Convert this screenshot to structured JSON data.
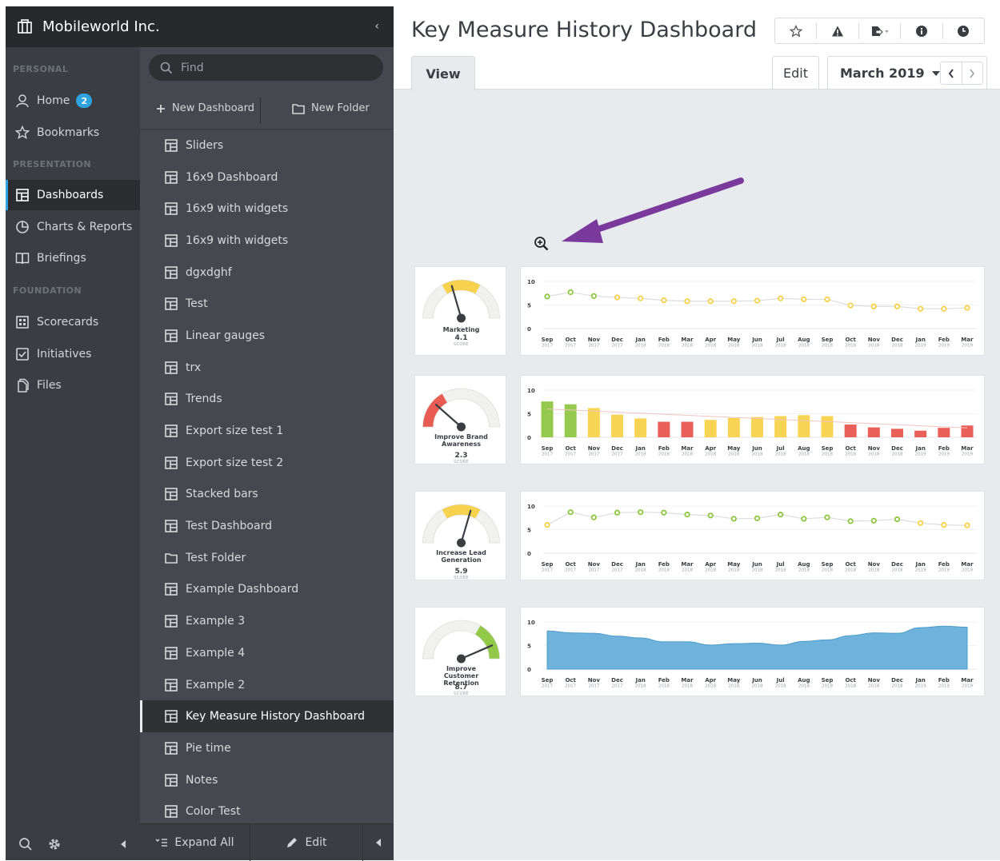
{
  "org": {
    "name": "Mobileworld Inc."
  },
  "nav": {
    "sections": {
      "personal": "PERSONAL",
      "presentation": "PRESENTATION",
      "foundation": "FOUNDATION"
    },
    "items": [
      {
        "label": "Home",
        "icon": "home-icon"
      },
      {
        "label": "Bookmarks",
        "icon": "star-icon"
      },
      {
        "label": "Dashboards",
        "icon": "dashboard-icon"
      },
      {
        "label": "Charts & Reports",
        "icon": "pie-icon"
      },
      {
        "label": "Briefings",
        "icon": "book-icon"
      },
      {
        "label": "Scorecards",
        "icon": "scorecard-icon"
      },
      {
        "label": "Initiatives",
        "icon": "checkbox-icon"
      },
      {
        "label": "Files",
        "icon": "file-icon"
      }
    ],
    "home_badge": "2"
  },
  "sidebar": {
    "find_placeholder": "Find",
    "new_dashboard": "New Dashboard",
    "new_folder": "New Folder",
    "items": [
      "Sliders",
      "16x9 Dashboard",
      "16x9 with widgets",
      "16x9 with widgets",
      "dgxdghf",
      "Test",
      "Linear gauges",
      "trx",
      "Trends",
      "Export size test 1",
      "Export size test 2",
      "Stacked bars",
      "Test Dashboard",
      "Test Folder",
      "Example Dashboard",
      "Example 3",
      "Example 4",
      "Example 2",
      "Key Measure History Dashboard",
      "Pie time",
      "Notes",
      "Color Test"
    ],
    "active_item": "Key Measure History Dashboard",
    "expand_all": "Expand All",
    "edit": "Edit"
  },
  "main": {
    "title": "Key Measure History Dashboard",
    "tab_view": "View",
    "tab_edit": "Edit",
    "period": "March 2019"
  },
  "colors": {
    "accent": "#2ea3de",
    "arrow": "#7a3a9c",
    "green": "#8dc63f",
    "yellow": "#f7d046",
    "red": "#e8534a",
    "area": "#6fb3dc"
  },
  "chart_data": [
    {
      "type": "line",
      "gauge_label": "Marketing",
      "score": "4.1",
      "score_label": "SCORE",
      "x": [
        "Sep 2017",
        "Oct 2017",
        "Nov 2017",
        "Dec 2017",
        "Jan 2018",
        "Feb 2018",
        "Mar 2018",
        "Apr 2018",
        "May 2018",
        "Jun 2018",
        "Jul 2018",
        "Aug 2018",
        "Sep 2018",
        "Oct 2018",
        "Nov 2018",
        "Dec 2018",
        "Jan 2019",
        "Feb 2019",
        "Mar 2019"
      ],
      "values": [
        6.8,
        7.7,
        6.9,
        6.6,
        6.4,
        6.0,
        5.8,
        5.8,
        5.8,
        5.9,
        6.4,
        6.2,
        6.2,
        4.9,
        4.7,
        4.7,
        4.2,
        4.2,
        4.4
      ],
      "ylim": [
        0,
        10
      ],
      "yticks": [
        0,
        5,
        10
      ]
    },
    {
      "type": "bar",
      "gauge_label": "Improve Brand Awareness",
      "score": "2.3",
      "score_label": "SCORE",
      "x": [
        "Sep 2017",
        "Oct 2017",
        "Nov 2017",
        "Dec 2017",
        "Jan 2018",
        "Feb 2018",
        "Mar 2018",
        "Apr 2018",
        "May 2018",
        "Jun 2018",
        "Jul 2018",
        "Aug 2018",
        "Sep 2018",
        "Oct 2018",
        "Nov 2018",
        "Dec 2018",
        "Jan 2019",
        "Feb 2019",
        "Mar 2019"
      ],
      "values": [
        7.6,
        7.0,
        6.2,
        4.8,
        4.0,
        3.3,
        3.3,
        3.7,
        4.1,
        4.3,
        4.5,
        4.7,
        4.5,
        2.7,
        2.1,
        1.8,
        1.4,
        2.0,
        2.5
      ],
      "ylim": [
        0,
        10
      ],
      "yticks": [
        0,
        5,
        10
      ]
    },
    {
      "type": "line",
      "gauge_label": "Increase Lead Generation",
      "score": "5.9",
      "score_label": "SCORE",
      "x": [
        "Sep 2017",
        "Oct 2017",
        "Nov 2017",
        "Dec 2017",
        "Jan 2018",
        "Feb 2018",
        "Mar 2018",
        "Apr 2018",
        "May 2018",
        "Jun 2018",
        "Jul 2018",
        "Aug 2018",
        "Sep 2018",
        "Oct 2018",
        "Nov 2018",
        "Dec 2018",
        "Jan 2019",
        "Feb 2019",
        "Mar 2019"
      ],
      "values": [
        6.0,
        8.7,
        7.6,
        8.6,
        8.7,
        8.6,
        8.2,
        8.0,
        7.3,
        7.4,
        8.2,
        7.3,
        7.6,
        6.8,
        6.9,
        7.2,
        6.4,
        6.0,
        5.9
      ],
      "ylim": [
        0,
        10
      ],
      "yticks": [
        0,
        5,
        10
      ]
    },
    {
      "type": "area",
      "gauge_label": "Improve Customer Retention",
      "score": "8.7",
      "score_label": "SCORE",
      "x": [
        "Sep 2017",
        "Oct 2017",
        "Nov 2017",
        "Dec 2017",
        "Jan 2018",
        "Feb 2018",
        "Mar 2018",
        "Apr 2018",
        "May 2018",
        "Jun 2018",
        "Jul 2018",
        "Aug 2018",
        "Sep 2018",
        "Oct 2018",
        "Nov 2018",
        "Dec 2018",
        "Jan 2019",
        "Feb 2019",
        "Mar 2019"
      ],
      "values": [
        8.1,
        7.7,
        7.6,
        7.0,
        6.6,
        5.8,
        5.8,
        5.1,
        5.4,
        5.5,
        5.1,
        5.9,
        6.2,
        7.1,
        7.7,
        7.6,
        8.8,
        9.1,
        8.9
      ],
      "ylim": [
        0,
        10
      ],
      "yticks": [
        0,
        5,
        10
      ]
    }
  ]
}
